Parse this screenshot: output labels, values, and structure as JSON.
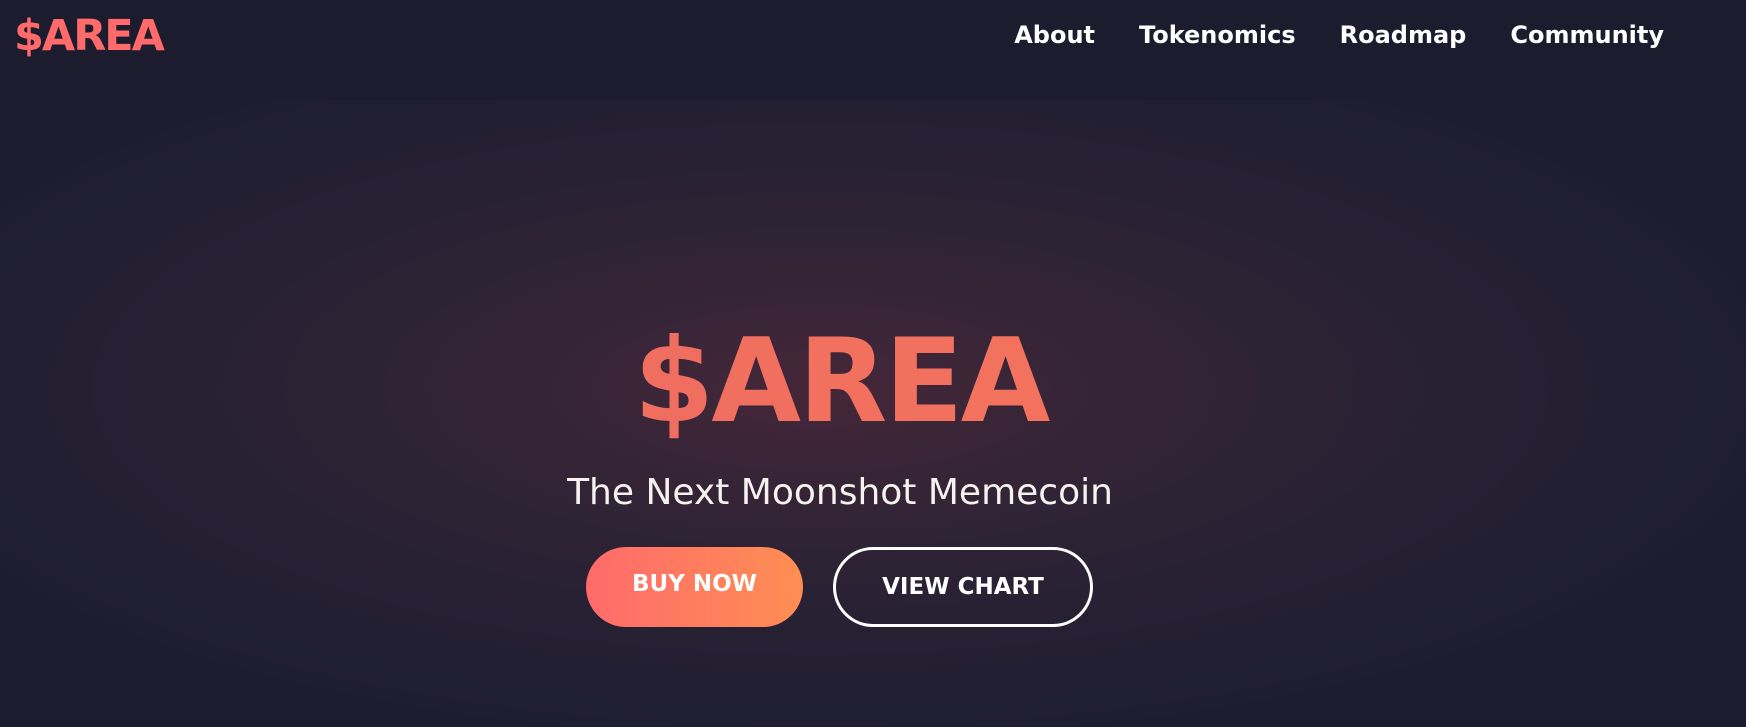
{
  "navbar": {
    "logo": "$AREA",
    "links": [
      {
        "label": "About"
      },
      {
        "label": "Tokenomics"
      },
      {
        "label": "Roadmap"
      },
      {
        "label": "Community"
      }
    ]
  },
  "hero": {
    "title": "$AREA",
    "subtitle": "The Next Moonshot Memecoin",
    "buttons": {
      "buy_label": "BUY NOW",
      "chart_label": "VIEW CHART"
    }
  },
  "colors": {
    "background": "#1c1c2e",
    "accent_start": "#ff6b6b",
    "accent_end": "#ff8e53",
    "text": "#ffffff"
  }
}
